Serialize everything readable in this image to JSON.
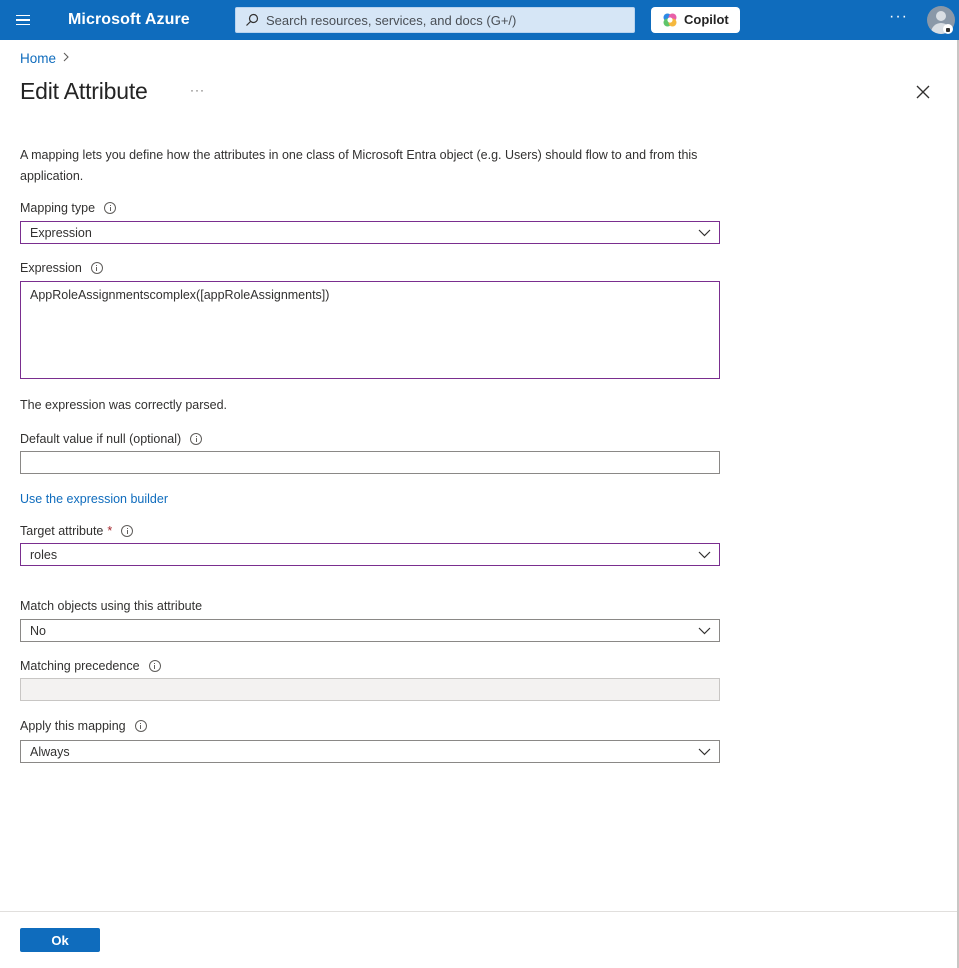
{
  "topbar": {
    "brand": "Microsoft Azure",
    "search_placeholder": "Search resources, services, and docs (G+/)",
    "copilot_label": "Copilot",
    "more": "···",
    "accent_color": "#0f6cbd"
  },
  "breadcrumb": {
    "home": "Home",
    "separator": ">"
  },
  "page": {
    "title": "Edit Attribute",
    "more": "···"
  },
  "form": {
    "description": "A mapping lets you define how the attributes in one class of Microsoft Entra object (e.g. Users) should flow to and from this application.",
    "mapping_type": {
      "label": "Mapping type",
      "value": "Expression"
    },
    "expression": {
      "label": "Expression",
      "value": "AppRoleAssignmentscomplex([appRoleAssignments])"
    },
    "parse_status": "The expression was correctly parsed.",
    "default_value": {
      "label": "Default value if null (optional)",
      "value": ""
    },
    "expression_builder_link": "Use the expression builder",
    "target_attribute": {
      "label": "Target attribute",
      "required_mark": "*",
      "value": "roles"
    },
    "match_objects": {
      "label": "Match objects using this attribute",
      "value": "No"
    },
    "matching_precedence": {
      "label": "Matching precedence",
      "value": ""
    },
    "apply_mapping": {
      "label": "Apply this mapping",
      "value": "Always"
    }
  },
  "footer": {
    "ok_label": "Ok"
  }
}
